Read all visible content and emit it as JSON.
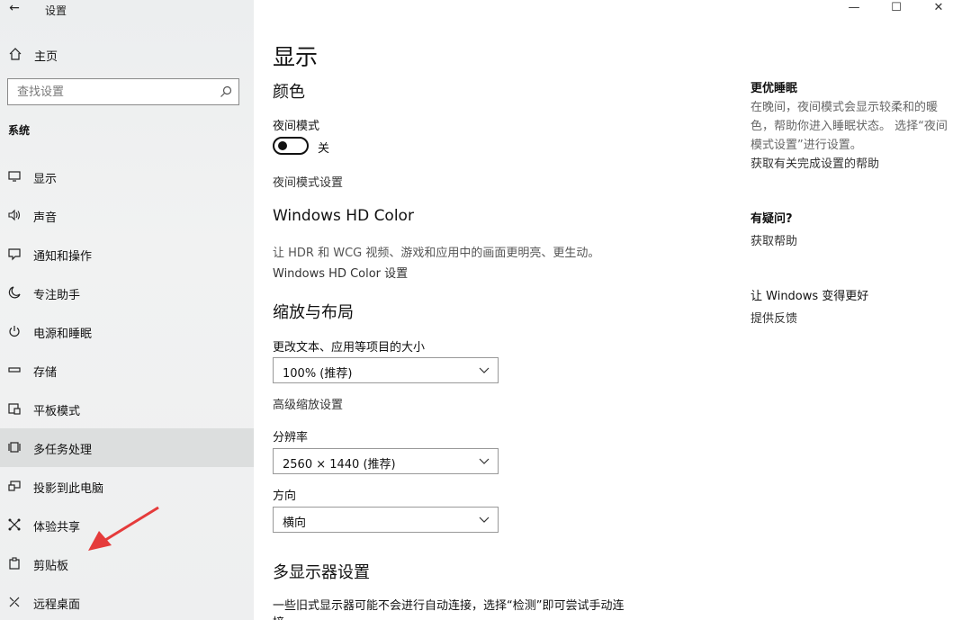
{
  "app": {
    "title": "设置",
    "back_glyph": "←"
  },
  "window": {
    "minimize": "—",
    "maximize": "☐",
    "close": "✕"
  },
  "sidebar": {
    "home_label": "主页",
    "search_placeholder": "查找设置",
    "section": "系统",
    "items": [
      {
        "label": "显示",
        "icon": "monitor-icon"
      },
      {
        "label": "声音",
        "icon": "speaker-icon"
      },
      {
        "label": "通知和操作",
        "icon": "notification-icon"
      },
      {
        "label": "专注助手",
        "icon": "moon-icon"
      },
      {
        "label": "电源和睡眠",
        "icon": "power-icon"
      },
      {
        "label": "存储",
        "icon": "storage-icon"
      },
      {
        "label": "平板模式",
        "icon": "tablet-icon"
      },
      {
        "label": "多任务处理",
        "icon": "multitask-icon",
        "active": true
      },
      {
        "label": "投影到此电脑",
        "icon": "project-icon"
      },
      {
        "label": "体验共享",
        "icon": "share-icon"
      },
      {
        "label": "剪贴板",
        "icon": "clipboard-icon"
      },
      {
        "label": "远程桌面",
        "icon": "remote-icon"
      }
    ]
  },
  "main": {
    "title": "显示",
    "color": {
      "heading": "颜色",
      "night_mode_label": "夜间模式",
      "night_mode_state": "关",
      "night_mode_settings": "夜间模式设置"
    },
    "hdr": {
      "heading": "Windows HD Color",
      "description": "让 HDR 和 WCG 视频、游戏和应用中的画面更明亮、更生动。",
      "settings_link": "Windows HD Color 设置"
    },
    "scale": {
      "heading": "缩放与布局",
      "size_label": "更改文本、应用等项目的大小",
      "size_value": "100% (推荐)",
      "advanced_link": "高级缩放设置",
      "resolution_label": "分辨率",
      "resolution_value": "2560 × 1440 (推荐)",
      "orientation_label": "方向",
      "orientation_value": "横向"
    },
    "multi": {
      "heading": "多显示器设置",
      "description": "一些旧式显示器可能不会进行自动连接，选择“检测”即可尝试手动连",
      "description_cont": "接。"
    }
  },
  "right_panel": {
    "sleep_title": "更优睡眠",
    "sleep_text": "在晚间，夜间模式会显示较柔和的暖色，帮助你进入睡眠状态。 选择“夜间模式设置”进行设置。",
    "sleep_link": "获取有关完成设置的帮助",
    "question_title": "有疑问?",
    "question_link": "获取帮助",
    "improve_title": "让 Windows 变得更好",
    "improve_link": "提供反馈"
  },
  "colors": {
    "sidebar_bg": "#eceeef",
    "active_item_bg": "#dcdede",
    "annotation_arrow": "#e53b3b"
  }
}
